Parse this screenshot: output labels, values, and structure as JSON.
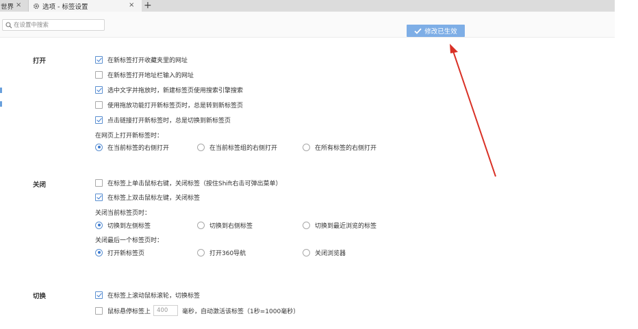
{
  "tabs": [
    {
      "label": "世界"
    },
    {
      "label": "选项 - 标签设置"
    }
  ],
  "new_tab_symbol": "+",
  "close_symbol": "×",
  "search": {
    "placeholder": "在设置中搜索"
  },
  "toast": {
    "label": "修改已生效",
    "bg_color": "#7eaee6"
  },
  "sections": {
    "open": {
      "title": "打开",
      "options": [
        {
          "label": "在新标签打开收藏夹里的网址",
          "checked": true
        },
        {
          "label": "在新标签打开地址栏输入的网址",
          "checked": false
        },
        {
          "label": "选中文字并拖放时，新建标签页使用搜索引擎搜索",
          "checked": true
        },
        {
          "label": "使用拖放功能打开新标签页时，总是转到新标签页",
          "checked": false
        },
        {
          "label": "点击链接打开新标签时，总是切换到新标签页",
          "checked": true
        }
      ],
      "position_label": "在网页上打开新标签时：",
      "position_options": [
        {
          "label": "在当前标签的右侧打开",
          "selected": true
        },
        {
          "label": "在当前标签组的右侧打开",
          "selected": false
        },
        {
          "label": "在所有标签的右侧打开",
          "selected": false
        }
      ]
    },
    "close": {
      "title": "关闭",
      "options": [
        {
          "label": "在标签上单击鼠标右键，关闭标签（按住Shift右击可弹出菜单）",
          "checked": false
        },
        {
          "label": "在标签上双击鼠标左键，关闭标签",
          "checked": true
        }
      ],
      "current_label": "关闭当前标签页时：",
      "current_options": [
        {
          "label": "切换到左侧标签",
          "selected": true
        },
        {
          "label": "切换到右侧标签",
          "selected": false
        },
        {
          "label": "切换到最近浏览的标签",
          "selected": false
        }
      ],
      "last_label": "关闭最后一个标签页时：",
      "last_options": [
        {
          "label": "打开新标签页",
          "selected": true
        },
        {
          "label": "打开360导航",
          "selected": false
        },
        {
          "label": "关闭浏览器",
          "selected": false
        }
      ]
    },
    "switch": {
      "title": "切换",
      "options": [
        {
          "label": "在标签上滚动鼠标滚轮，切换标签",
          "checked": true
        }
      ],
      "hover": {
        "checked": false,
        "prefix": "鼠标悬停标签上",
        "value": "400",
        "suffix": "毫秒，自动激活该标签（1秒=1000毫秒）"
      }
    }
  },
  "accent_color": "#3b7ad0",
  "arrow_color": "#d93025"
}
